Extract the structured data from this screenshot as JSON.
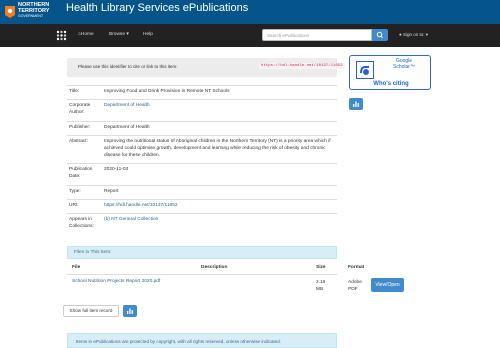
{
  "brand": {
    "logo_line1": "NORTHERN",
    "logo_line2": "TERRITORY",
    "logo_line3": "GOVERNMENT",
    "site_title": "Health Library Services ePublications"
  },
  "nav": {
    "home": "Home",
    "browse": "Browse",
    "help": "Help",
    "search_placeholder": "Search ePublications",
    "signin": "Sign on to:"
  },
  "identifier": {
    "label": "Please use this identifier to cite or link to this item:",
    "url": "https://hdl.handle.net/10137/11652"
  },
  "metadata": [
    {
      "label": "Title:",
      "value": "Improving Food and Drink Provision in Remote NT Schools",
      "link": false
    },
    {
      "label": "Corporate Author:",
      "value": "Department of Health",
      "link": true
    },
    {
      "label": "Publisher:",
      "value": "Department of Health",
      "link": false
    },
    {
      "label": "Abstract:",
      "value": "Improving the nutritional status of Aboriginal children in the Northern Territory (NT) is a priority area which if achieved could optimise growth, development and learning while reducing the risk of obesity and chronic disease for these children.",
      "link": false
    },
    {
      "label": "Publication Date:",
      "value": "2020-11-03",
      "link": false
    },
    {
      "label": "Type:",
      "value": "Report",
      "link": false
    },
    {
      "label": "URI:",
      "value": "https://hdl.handle.net/10137/11652",
      "link": true
    },
    {
      "label": "Appears in Collections:",
      "value": "(b) NT General Collection",
      "link": true
    }
  ],
  "scholar": {
    "line1": "Google",
    "line2": "Scholar™",
    "whos_citing": "Who's citing"
  },
  "files": {
    "panel_title": "Files in This Item:",
    "headers": {
      "file": "File",
      "description": "Description",
      "size": "Size",
      "format": "Format"
    },
    "row": {
      "file": "School Nutrition Projects Report 2020.pdf",
      "description": "",
      "size_line1": "2.16",
      "size_line2": "MB",
      "format_line1": "Adobe",
      "format_line2": "PDF",
      "button": "View/Open"
    }
  },
  "full_record_button": "Show full item record",
  "copyright_notice": "Items in ePublications are protected by copyright, with all rights reserved, unless otherwise indicated.",
  "colors": {
    "header": "#05558b",
    "navbar": "#222222",
    "primary": "#428bca",
    "info_bg": "#d9edf7"
  }
}
